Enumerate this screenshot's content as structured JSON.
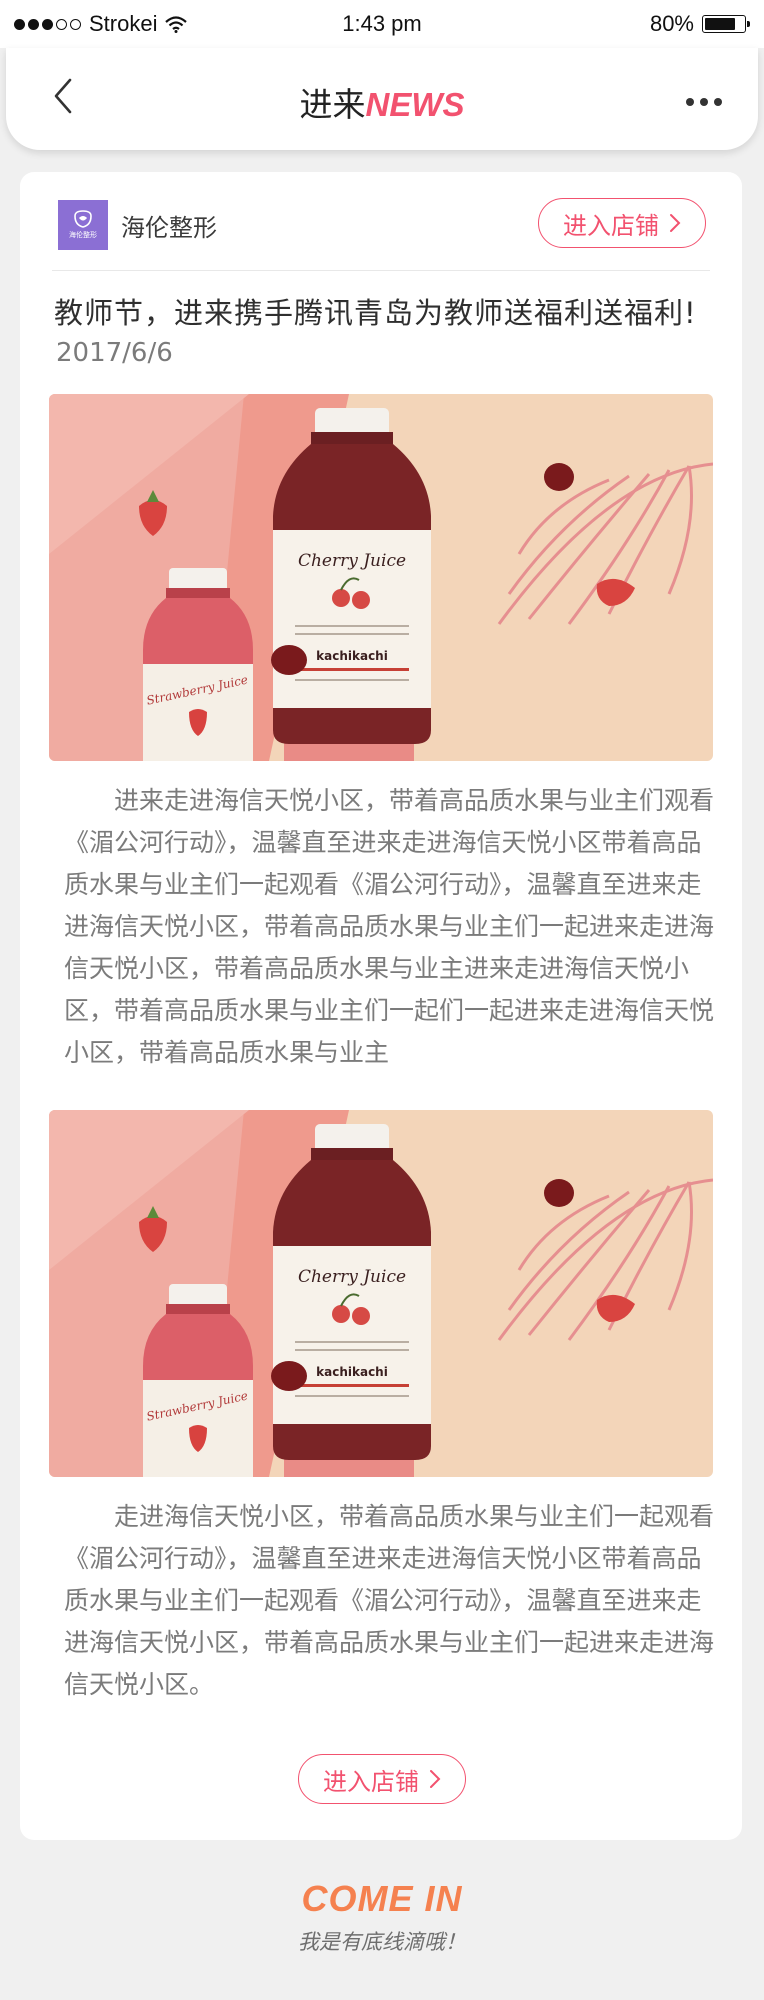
{
  "status_bar": {
    "carrier": "Strokei",
    "time": "1:43 pm",
    "battery": "80%",
    "battery_level": 0.8,
    "signal_icon": "signal-dots-icon",
    "wifi_icon": "wifi-icon"
  },
  "nav": {
    "title_main": "进来",
    "title_accent": "NEWS",
    "back_icon": "chevron-left-icon",
    "more_icon": "more-dots-icon"
  },
  "shop": {
    "logo_text": "海伦整形",
    "name": "海伦整形",
    "enter_label": "进入店铺",
    "enter_icon": "chevron-right-icon"
  },
  "article": {
    "title": "教师节，进来携手腾讯青岛为教师送福利送福利!",
    "date": "2017/6/6",
    "paragraph_1": "进来走进海信天悦小区，带着高品质水果与业主们观看《湄公河行动》，温馨直至进来走进海信天悦小区带着高品质水果与业主们一起观看《湄公河行动》，温馨直至进来走进海信天悦小区，带着高品质水果与业主们一起进来走进海信天悦小区，带着高品质水果与业主进来走进海信天悦小区，带着高品质水果与业主们一起们一起进来走进海信天悦小区，带着高品质水果与业主",
    "paragraph_2": "走进海信天悦小区，带着高品质水果与业主们一起观看《湄公河行动》，温馨直至进来走进海信天悦小区带着高品质水果与业主们一起观看《湄公河行动》，温馨直至进来走进海信天悦小区，带着高品质水果与业主们一起进来走进海信天悦小区。",
    "image": {
      "big_bottle_label": "Cherry Juice",
      "big_bottle_brand": "kachikachi",
      "small_bottle_label": "Strawberry Juice"
    }
  },
  "bottom_button": {
    "label": "进入店铺",
    "icon": "chevron-right-icon"
  },
  "footer": {
    "title": "COME IN",
    "subtitle": "我是有底线滴哦！"
  },
  "colors": {
    "accent": "#f2526f",
    "footer_accent": "#f5814f",
    "body_text": "#7b7b7b",
    "title_text": "#2f2f2f"
  }
}
